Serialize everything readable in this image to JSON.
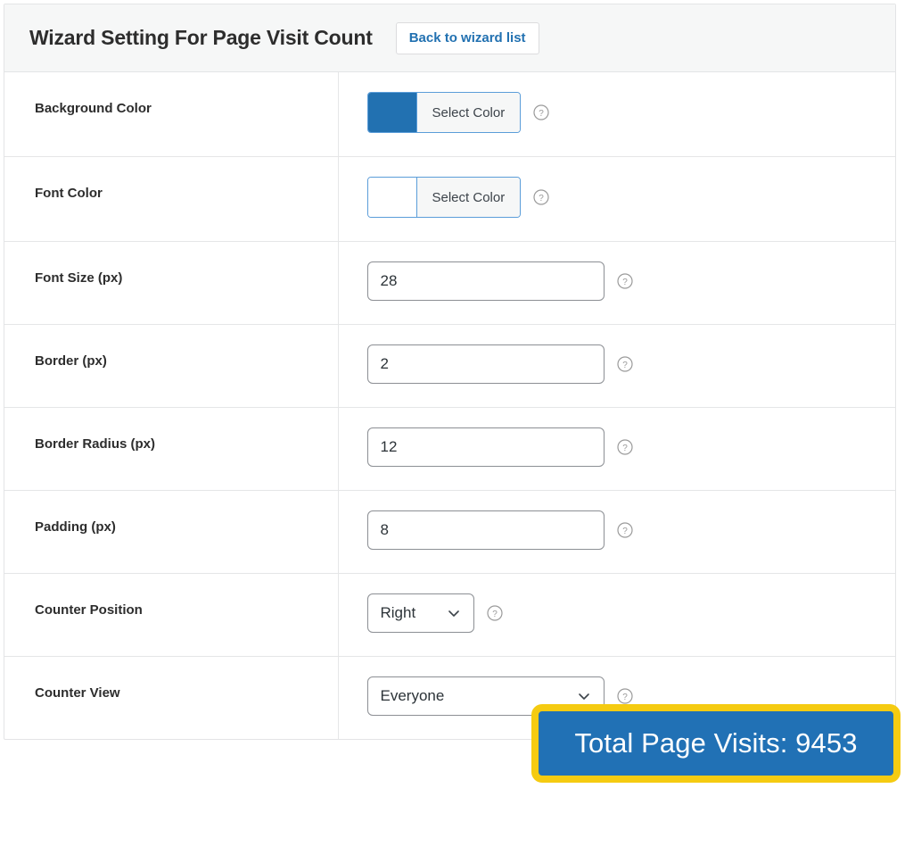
{
  "header": {
    "title": "Wizard Setting For Page Visit Count",
    "back_button_label": "Back to wizard list"
  },
  "rows": [
    {
      "label": "Background Color",
      "control": "color",
      "button_label": "Select Color",
      "swatch_color": "#2271b1",
      "help": "?"
    },
    {
      "label": "Font Color",
      "control": "color",
      "button_label": "Select Color",
      "swatch_color": "#ffffff",
      "help": "?"
    },
    {
      "label": "Font Size (px)",
      "control": "text",
      "value": "28",
      "placeholder": "",
      "help": "?"
    },
    {
      "label": "Border (px)",
      "control": "text",
      "value": "2",
      "placeholder": "",
      "help": "?"
    },
    {
      "label": "Border Radius (px)",
      "control": "text",
      "value": "12",
      "placeholder": "",
      "help": "?"
    },
    {
      "label": "Padding (px)",
      "control": "text",
      "value": "8",
      "placeholder": "",
      "help": "?"
    },
    {
      "label": "Counter Position",
      "control": "select-narrow",
      "value": "Right",
      "help": "?"
    },
    {
      "label": "Counter View",
      "control": "select-wide",
      "value": "Everyone",
      "help": "?"
    }
  ],
  "preview": {
    "counter_text": "Total Page Visits: 9453",
    "background_color": "#2171b5",
    "border_color": "#f5cb11",
    "font_color": "#ffffff"
  },
  "icons": {
    "help": "help-circle-icon",
    "chevron": "chevron-down-icon"
  }
}
